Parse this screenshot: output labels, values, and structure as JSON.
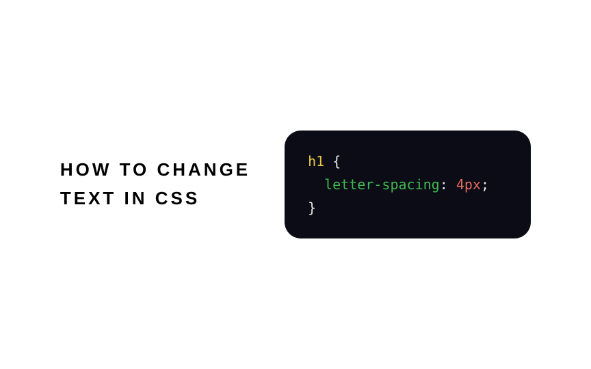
{
  "heading": {
    "line1": "How to change",
    "line2": "text in CSS"
  },
  "code": {
    "selector": "h1",
    "open_brace": " {",
    "property": "letter-spacing",
    "colon": ": ",
    "value": "4px",
    "semicolon": ";",
    "close_brace": "}"
  }
}
